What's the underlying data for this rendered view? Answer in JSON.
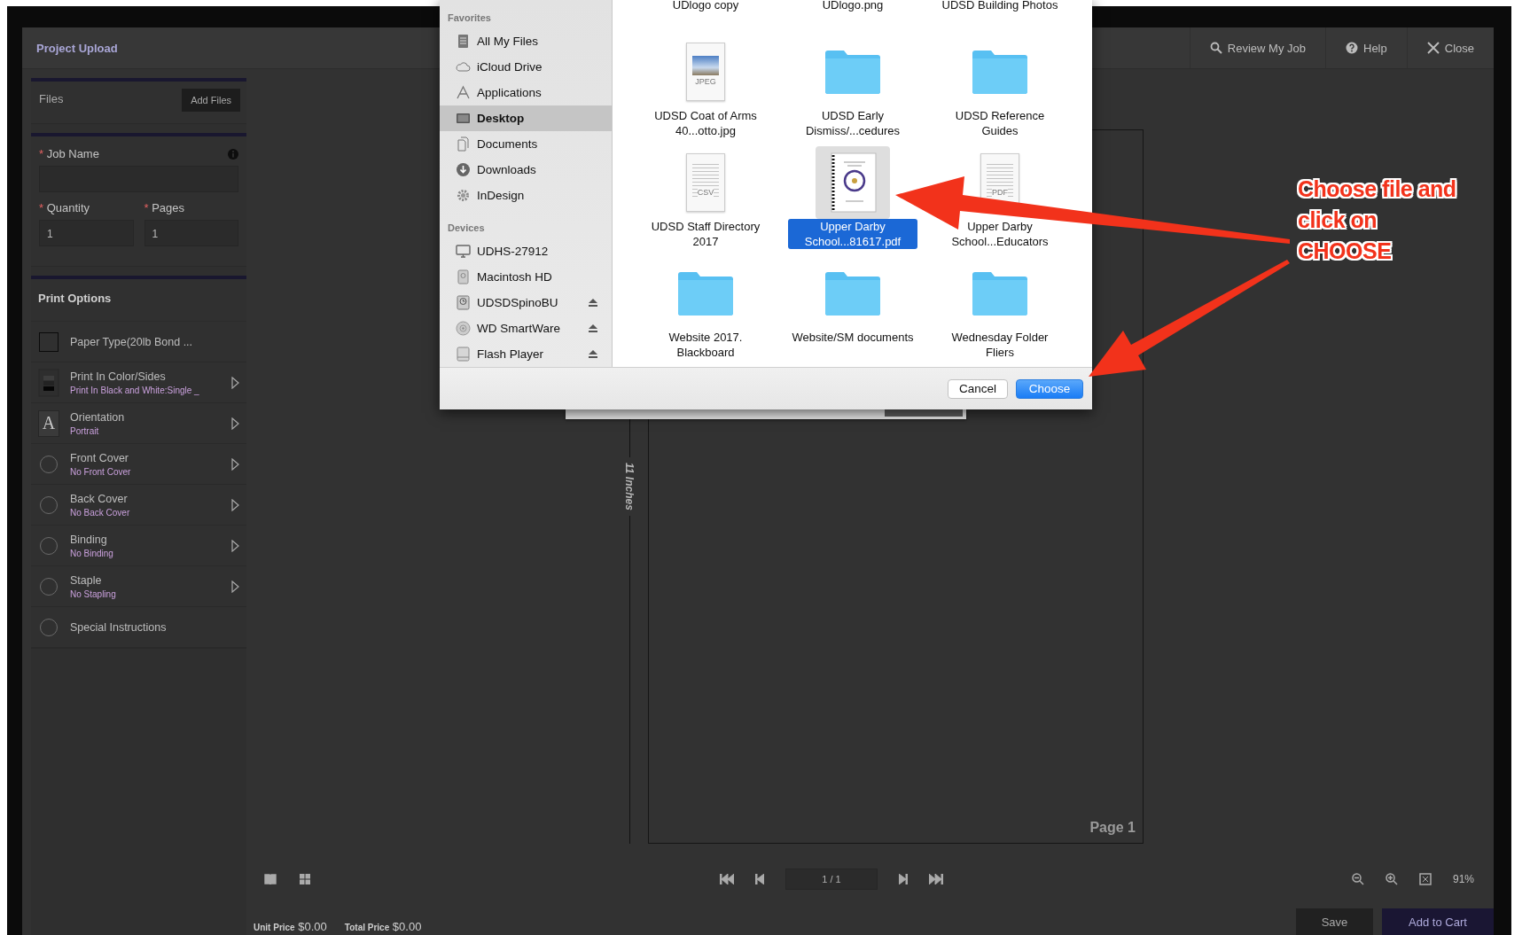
{
  "app": {
    "title": "Project Upload",
    "header_actions": [
      {
        "kind": "search",
        "label": "Review My Job"
      },
      {
        "kind": "help",
        "label": "Help"
      },
      {
        "kind": "close",
        "label": "Close"
      }
    ]
  },
  "files_section": {
    "label": "Files",
    "button": "Add Files"
  },
  "job_form": {
    "job_name": {
      "mark": "*",
      "label": "Job Name"
    },
    "quantity": {
      "mark": "*",
      "label": "Quantity",
      "value": "1"
    },
    "pages": {
      "mark": "*",
      "label": "Pages",
      "value": "1"
    }
  },
  "print_options": {
    "title": "Print Options",
    "items": [
      {
        "kind": "square",
        "label": "Paper Type(20lb Bond ...",
        "expandable": false
      },
      {
        "kind": "stack",
        "label": "Print In Color/Sides",
        "value": "Print In Black and White:Single _",
        "expandable": true
      },
      {
        "kind": "letter",
        "icon_text": "A",
        "label": "Orientation",
        "value": "Portrait",
        "expandable": true
      },
      {
        "kind": "circle",
        "label": "Front Cover",
        "value": "No Front Cover",
        "expandable": true
      },
      {
        "kind": "circle",
        "label": "Back Cover",
        "value": "No Back Cover",
        "expandable": true
      },
      {
        "kind": "circle",
        "label": "Binding",
        "value": "No Binding",
        "expandable": true
      },
      {
        "kind": "circle",
        "label": "Staple",
        "value": "No Stapling",
        "expandable": true
      },
      {
        "kind": "circle",
        "label": "Special Instructions",
        "expandable": false
      }
    ]
  },
  "preview": {
    "ruler_label": "11 Inches",
    "page_label": "Page 1"
  },
  "toolbar": {
    "page_field": "1 / 1",
    "zoom": "91%"
  },
  "prices": [
    {
      "label": "Unit Price",
      "value": "$0.00"
    },
    {
      "label": "Total Price",
      "value": "$0.00"
    }
  ],
  "actions": [
    {
      "kind": "secondary",
      "label": "Save"
    },
    {
      "kind": "primary",
      "label": "Add to Cart"
    }
  ],
  "dialog": {
    "sidebar": [
      {
        "heading": "Favorites",
        "items": [
          {
            "kind": "files",
            "label": "All My Files",
            "selected": false,
            "ejectable": false
          },
          {
            "kind": "cloud",
            "label": "iCloud Drive",
            "selected": false,
            "ejectable": false
          },
          {
            "kind": "apps",
            "label": "Applications",
            "selected": false,
            "ejectable": false
          },
          {
            "kind": "desktop",
            "label": "Desktop",
            "selected": true,
            "ejectable": false
          },
          {
            "kind": "documents",
            "label": "Documents",
            "selected": false,
            "ejectable": false
          },
          {
            "kind": "downloads",
            "label": "Downloads",
            "selected": false,
            "ejectable": false
          },
          {
            "kind": "gear",
            "label": "InDesign",
            "selected": false,
            "ejectable": false
          }
        ]
      },
      {
        "heading": "Devices",
        "items": [
          {
            "kind": "computer",
            "label": "UDHS-27912",
            "selected": false,
            "ejectable": false
          },
          {
            "kind": "disk",
            "label": "Macintosh HD",
            "selected": false,
            "ejectable": false
          },
          {
            "kind": "backup",
            "label": "UDSDSpinoBU",
            "selected": false,
            "ejectable": true
          },
          {
            "kind": "disc",
            "label": "WD SmartWare",
            "selected": false,
            "ejectable": true
          },
          {
            "kind": "drive",
            "label": "Flash Player",
            "selected": false,
            "ejectable": true
          }
        ]
      }
    ],
    "files": [
      {
        "kind": "image",
        "name": "UDlogo copy",
        "selected": false
      },
      {
        "kind": "image",
        "name": "UDlogo.png",
        "selected": false
      },
      {
        "kind": "folder",
        "name": "UDSD Building Photos",
        "selected": false
      },
      {
        "kind": "image",
        "badge": "JPEG",
        "name": "UDSD Coat of Arms 40...otto.jpg",
        "selected": false
      },
      {
        "kind": "folder",
        "name": "UDSD Early Dismiss/...cedures",
        "selected": false
      },
      {
        "kind": "folder",
        "name": "UDSD Reference Guides",
        "selected": false
      },
      {
        "kind": "sheet",
        "badge": "CSV",
        "name": "UDSD Staff Directory 2017",
        "selected": false
      },
      {
        "kind": "booklet",
        "name": "Upper Darby School...81617.pdf",
        "selected": true
      },
      {
        "kind": "document",
        "badge": "PDF",
        "name": "Upper Darby School...Educators",
        "selected": false
      },
      {
        "kind": "folder",
        "name": "Website 2017. Blackboard",
        "selected": false
      },
      {
        "kind": "folder",
        "name": "Website/SM documents",
        "selected": false
      },
      {
        "kind": "folder",
        "name": "Wednesday Folder Fliers",
        "selected": false
      }
    ],
    "buttons": [
      {
        "kind": "default",
        "label": "Cancel"
      },
      {
        "kind": "action",
        "label": "Choose"
      }
    ]
  },
  "annotation": {
    "lines": [
      "Choose file and",
      "click on",
      "CHOOSE"
    ]
  }
}
